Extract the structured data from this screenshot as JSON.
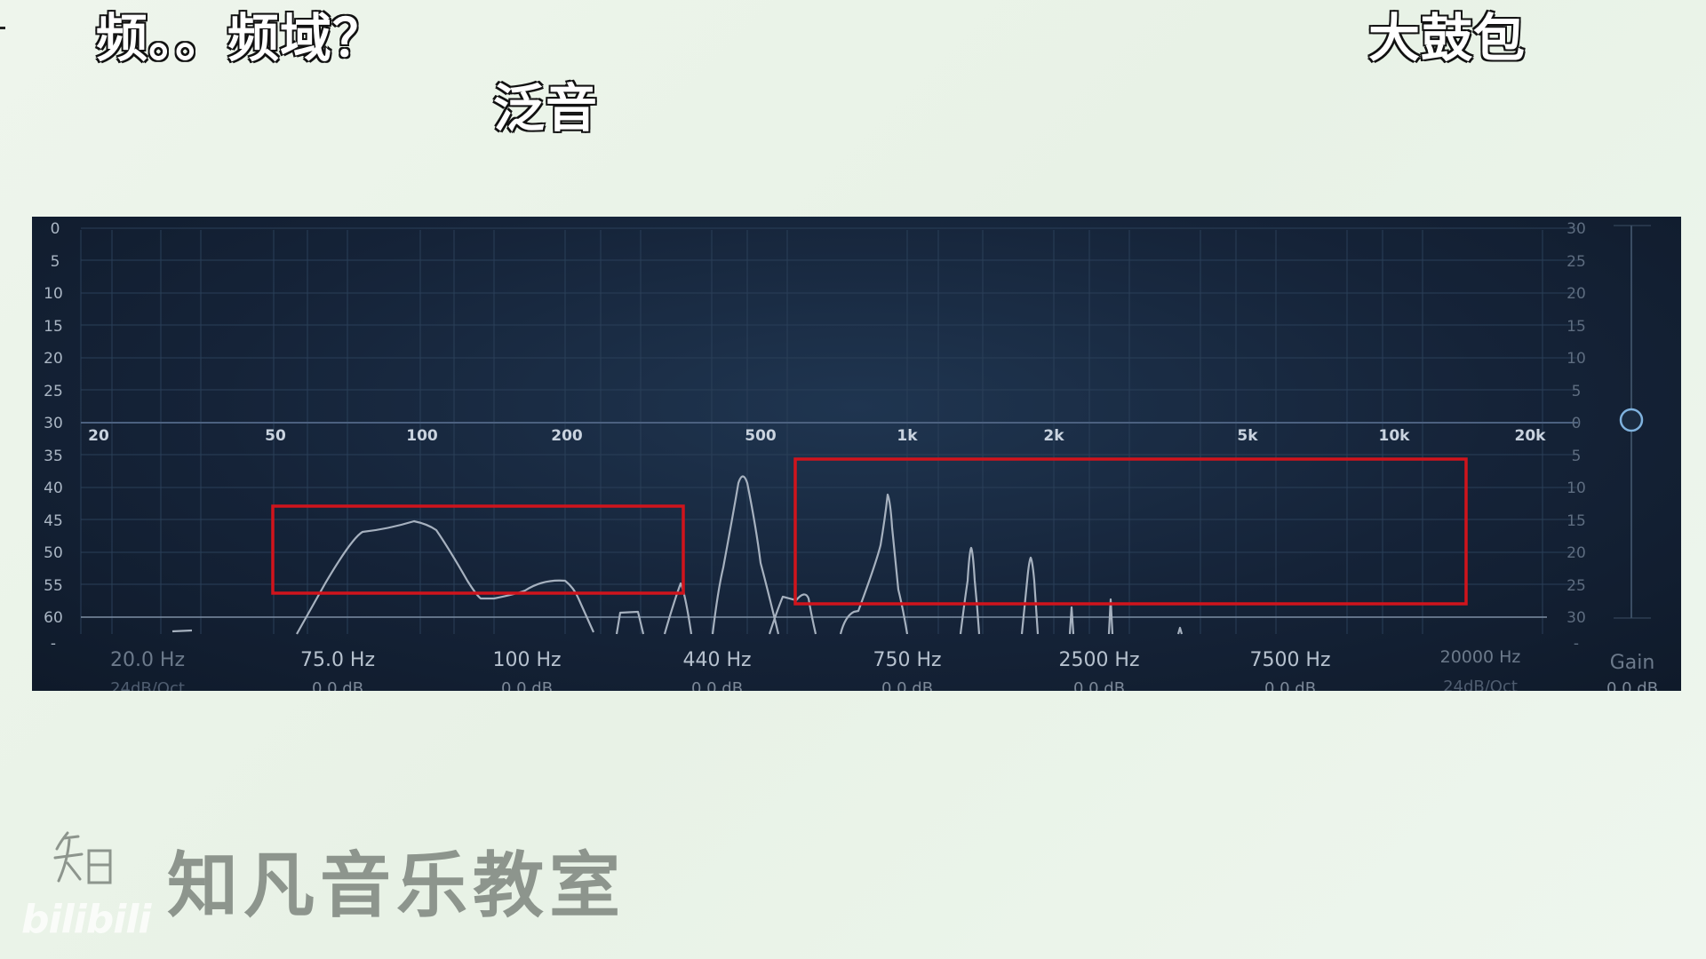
{
  "captions": [
    "频。。频域？",
    "泛音",
    "大鼓包"
  ],
  "eq": {
    "left_scale": [
      "0",
      "5",
      "10",
      "15",
      "20",
      "25",
      "30",
      "35",
      "40",
      "45",
      "50",
      "55",
      "60",
      "-"
    ],
    "right_scale": [
      "30",
      "25",
      "20",
      "15",
      "10",
      "5",
      "0",
      "5",
      "10",
      "15",
      "20",
      "25",
      "30",
      "-"
    ],
    "freq_ticks": [
      "20",
      "50",
      "100",
      "200",
      "500",
      "1k",
      "2k",
      "5k",
      "10k",
      "20k"
    ],
    "bands": [
      {
        "freq": "20.0 Hz",
        "gain": "24dB/Oct",
        "dim": true
      },
      {
        "freq": "75.0 Hz",
        "gain": "0.0 dB",
        "dim": false
      },
      {
        "freq": "100 Hz",
        "gain": "0.0 dB",
        "dim": false
      },
      {
        "freq": "440 Hz",
        "gain": "0.0 dB",
        "dim": false
      },
      {
        "freq": "750 Hz",
        "gain": "0.0 dB",
        "dim": false
      },
      {
        "freq": "2500 Hz",
        "gain": "0.0 dB",
        "dim": false
      },
      {
        "freq": "7500 Hz",
        "gain": "0.0 dB",
        "dim": false
      },
      {
        "freq": "20000 Hz",
        "gain": "24dB/Oct",
        "dim": true
      }
    ],
    "gain": {
      "label": "Gain",
      "value": "0.0 dB"
    },
    "highlight_color": "#d0141c",
    "spectrum_color": "#a6b1bf"
  },
  "brand": {
    "name": "知凡音乐教室",
    "watermark": "bilibili"
  }
}
